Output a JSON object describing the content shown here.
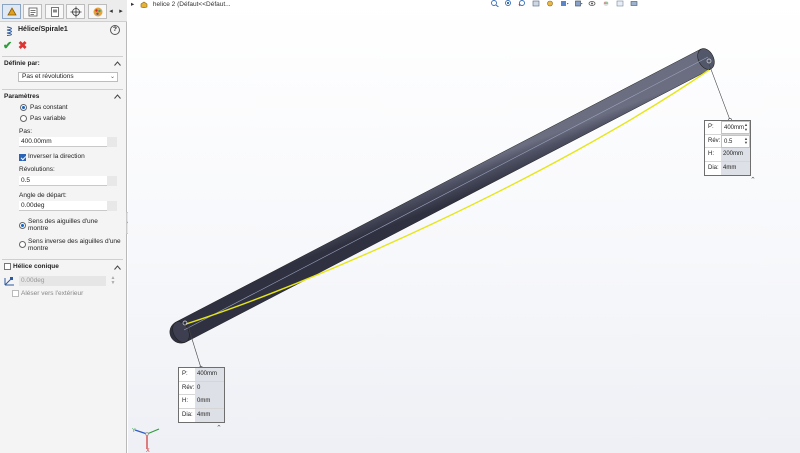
{
  "panel": {
    "tabs": [
      {
        "icon": "feature-manager-icon",
        "active": true
      },
      {
        "icon": "property-manager-icon",
        "active": false
      },
      {
        "icon": "configuration-manager-icon",
        "active": false
      },
      {
        "icon": "dimxpert-icon",
        "active": false
      },
      {
        "icon": "display-manager-icon",
        "active": false
      }
    ],
    "title": "Hélice/Spirale1",
    "help_label": "?",
    "ok_glyph": "✔",
    "cancel_glyph": "✖",
    "defined_by": {
      "header": "Définie par:",
      "selected": "Pas et révolutions"
    },
    "parameters": {
      "header": "Paramètres",
      "pitch_mode_options": [
        {
          "label": "Pas constant",
          "selected": true
        },
        {
          "label": "Pas variable",
          "selected": false
        }
      ],
      "pitch_label": "Pas:",
      "pitch_value": "400.00mm",
      "reverse_label": "Inverser la direction",
      "reverse_checked": true,
      "revolutions_label": "Révolutions:",
      "revolutions_value": "0.5",
      "start_angle_label": "Angle de départ:",
      "start_angle_value": "0.00deg",
      "direction_options": [
        {
          "label_line1": "Sens des aiguilles d'une",
          "label_line2": "montre",
          "selected": true
        },
        {
          "label_line1": "Sens inverse des aiguilles d'une",
          "label_line2": "montre",
          "selected": false
        }
      ]
    },
    "tapered": {
      "header": "Hélice conique",
      "checked": false,
      "angle_value": "0.00deg",
      "outward_label": "Aléser vers l'extérieur",
      "outward_checked": false
    }
  },
  "viewport": {
    "breadcrumb_arrow": "▸",
    "breadcrumb": "helice 2  (Défaut<<Défaut...",
    "colors": {
      "cylinder": "#4a4c5c",
      "helix": "#e6e617",
      "background": "#f4f5f8"
    },
    "callout_end": {
      "rows": [
        {
          "label": "P:",
          "value": "400mm",
          "spinner": true
        },
        {
          "label": "Rév:",
          "value": "0.5",
          "spinner": true
        },
        {
          "label": "H:",
          "value": "200mm",
          "spinner": false
        },
        {
          "label": "Dia:",
          "value": "4mm",
          "spinner": false
        }
      ]
    },
    "callout_start": {
      "rows": [
        {
          "label": "P:",
          "value": "400mm"
        },
        {
          "label": "Rév:",
          "value": "0"
        },
        {
          "label": "H:",
          "value": "0mm"
        },
        {
          "label": "Dia:",
          "value": "4mm"
        }
      ]
    },
    "triad": {
      "x_label": "X",
      "y_label": "Y"
    }
  }
}
